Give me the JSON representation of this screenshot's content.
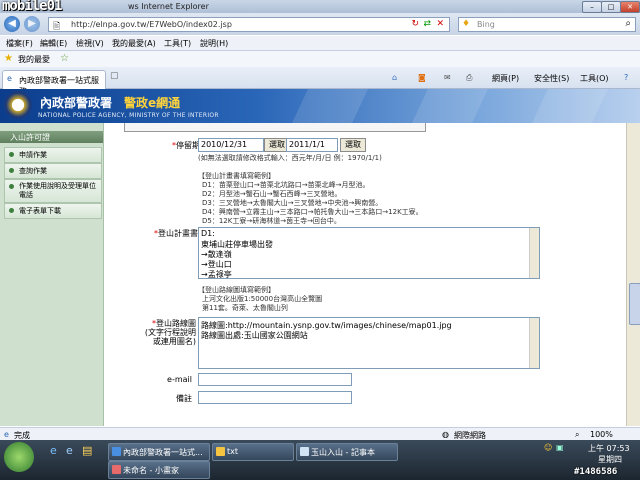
{
  "window": {
    "logo_text": "mobile01",
    "title_suffix": "ws Internet Explorer"
  },
  "address": {
    "url": "http://elnpa.gov.tw/E7WebO/index02.jsp",
    "search_placeholder": "Bing"
  },
  "menu": [
    "檔案(F)",
    "編輯(E)",
    "檢視(V)",
    "我的最愛(A)",
    "工具(T)",
    "說明(H)"
  ],
  "favorites_label": "我的最愛",
  "tab": {
    "title": "內政部警政署一站式服務"
  },
  "toolbar": {
    "page": "網頁(P)",
    "safety": "安全性(S)",
    "tools": "工具(O)"
  },
  "header": {
    "org": "內政部警政署",
    "brand": "警政e網通",
    "english": "NATIONAL POLICE AGENCY, MINISTRY OF THE INTERIOR"
  },
  "sidebar": {
    "heading": "入山許可證",
    "items": [
      "申請作業",
      "查詢作業",
      "作業使用說明及受理單位電話",
      "電子表單下載"
    ]
  },
  "form": {
    "stay_period_label": "停留期間",
    "date_from": "2010/12/31",
    "date_to": "2011/1/1",
    "pick_button": "選取",
    "date_dash": "～",
    "date_hint": "(如無法選取請修改格式輸入：西元年/月/日 例：1970/1/1)",
    "plan_example_title": "【登山計畫書填寫範例】",
    "plan_examples": [
      "D1：苗栗登山口→苗栗北坑路口→苗栗北峰→月型池。",
      "D2：月型池→蟹石山→蟹石西峰→三叉營地。",
      "D3：三叉營地→太魯閣大山→三叉營地→中央池→興南營。",
      "D4：興南營→立霧主山→三本路口→帕托魯大山→三本路口→12K工寮。",
      "D5：12K工寮→研海林道→茵王寺→回台中。"
    ],
    "plan_label": "登山計畫書",
    "plan_text": [
      "D1:",
      "東埔山莊停車場出發",
      "→散逢嶺",
      "→登山口",
      "→孟祿亭"
    ],
    "route_example_title": "【登山路線圖填寫範例】",
    "route_examples": [
      "上河文化出版1:50000台灣高山全覽圖",
      "第11套。奇萊、太魯閣山列"
    ],
    "route_label_lines": [
      "登山路線圖",
      "(文字行程說明",
      "或連用圖名)"
    ],
    "route_text": [
      "路線圖:http://mountain.ysnp.gov.tw/images/chinese/map01.jpg",
      "路線圖出處:玉山國家公園網站"
    ],
    "email_label": "e-mail",
    "note_label": "備註"
  },
  "status": {
    "left": "完成",
    "zone": "網際網路",
    "zoom": "100%"
  },
  "taskbar": {
    "buttons": [
      "內政部警政署一站式...",
      "txt",
      "玉山入山 - 記事本",
      "未命名 - 小畫家"
    ],
    "time": "上午 07:53",
    "day": "星期四",
    "watermark": "#1486586"
  },
  "colors": {
    "required": "#dd0000",
    "header_blue": "#0b3d8c",
    "brand_yellow": "#ffd33a",
    "sidebar_green": "#cfe0cf"
  }
}
